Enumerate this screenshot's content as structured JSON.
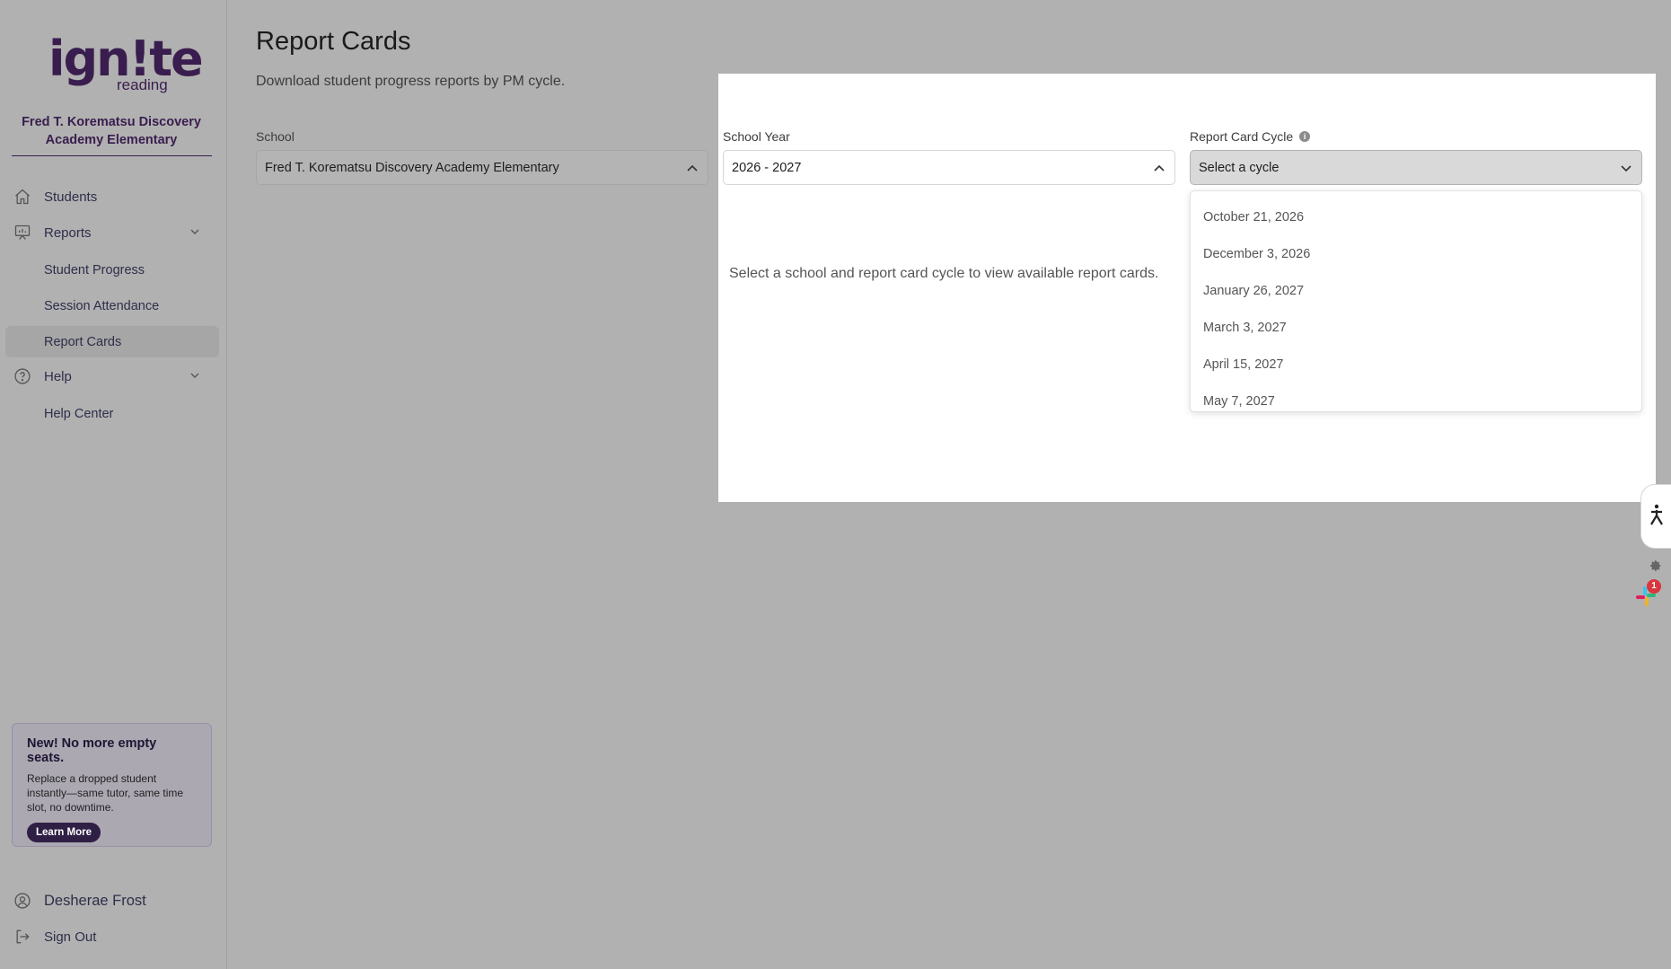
{
  "app": {
    "logo_word": "ign!te",
    "logo_sub": "reading",
    "school_name": "Fred T. Korematsu Discovery Academy Elementary"
  },
  "sidebar": {
    "students": "Students",
    "reports": "Reports",
    "reports_items": [
      "Student Progress",
      "Session Attendance",
      "Report Cards"
    ],
    "help": "Help",
    "help_items": [
      "Help Center"
    ]
  },
  "promo": {
    "title": "New! No more empty seats.",
    "text": "Replace a dropped student instantly—same tutor, same time slot, no downtime.",
    "button": "Learn More"
  },
  "user": {
    "name": "Desherae Frost",
    "sign_out": "Sign Out"
  },
  "page": {
    "title": "Report Cards",
    "subtitle": "Download student progress reports by PM cycle.",
    "empty_message": "Select a school and report card cycle to view available report cards."
  },
  "filters": {
    "school_label": "School",
    "school_value": "Fred T. Korematsu Discovery Academy Elementary",
    "year_label": "School Year",
    "year_value": "2026 - 2027",
    "cycle_label": "Report Card Cycle",
    "cycle_value": "Select a cycle",
    "cycle_options": [
      "October 21, 2026",
      "December 3, 2026",
      "January 26, 2027",
      "March 3, 2027",
      "April 15, 2027",
      "May 7, 2027"
    ]
  },
  "widgets": {
    "slack_badge": "1"
  },
  "colors": {
    "brand": "#3a1d4f",
    "accent": "#b71569",
    "badge": "#d9363e"
  }
}
